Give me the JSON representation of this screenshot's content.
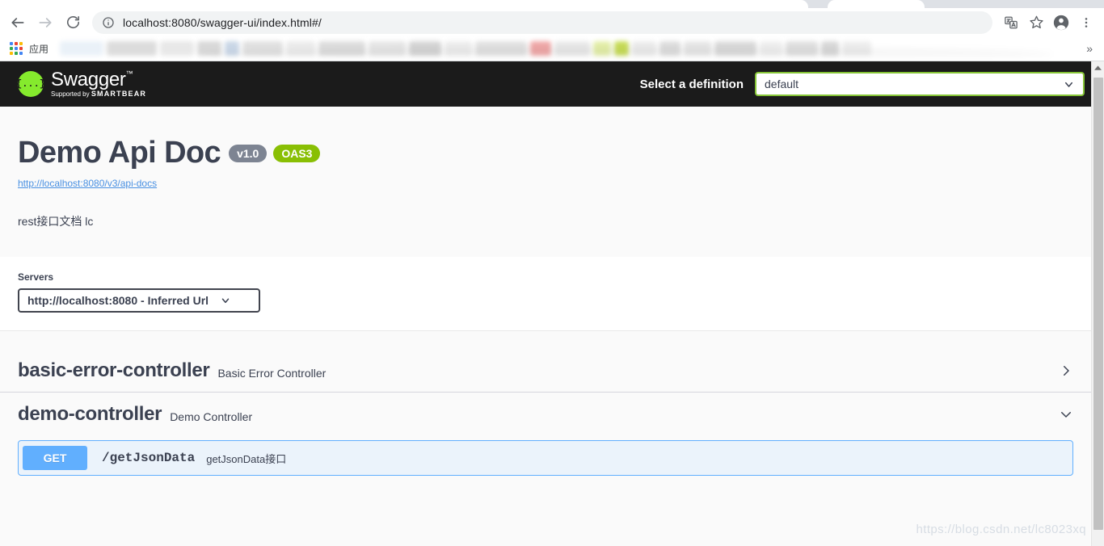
{
  "browser": {
    "nav": {
      "back_title": "Back",
      "forward_title": "Forward",
      "reload_title": "Reload"
    },
    "omnibox": {
      "url": "localhost:8080/swagger-ui/index.html#/",
      "placeholder": "Search Google or type a URL",
      "security_icon": "info-circle-icon"
    },
    "toolbar_icons": [
      "translate-icon",
      "bookmark-star-icon",
      "profile-avatar-icon",
      "more-menu-icon"
    ],
    "bookmarks": {
      "apps_label": "应用",
      "overflow_label": "»"
    }
  },
  "topbar": {
    "logo_mark": "{...}",
    "brand": "Swagger",
    "trademark": "™",
    "supported_prefix": "Supported by",
    "supported_brand": "SMARTBEAR",
    "select_label": "Select a definition",
    "definition_value": "default",
    "chevron": "chevron-down-icon"
  },
  "info": {
    "title": "Demo Api Doc",
    "version_badge": "v1.0",
    "oas_badge": "OAS3",
    "url": "http://localhost:8080/v3/api-docs",
    "description": "rest接口文档 lc"
  },
  "servers": {
    "label": "Servers",
    "selected": "http://localhost:8080 - Inferred Url",
    "options": [
      "http://localhost:8080 - Inferred Url"
    ]
  },
  "tags": [
    {
      "name": "basic-error-controller",
      "description": "Basic Error Controller",
      "expanded": false,
      "chevron": "chevron-right-icon",
      "operations": []
    },
    {
      "name": "demo-controller",
      "description": "Demo Controller",
      "expanded": true,
      "chevron": "chevron-down-icon",
      "operations": [
        {
          "method": "GET",
          "path": "/getJsonData",
          "summary": "getJsonData接口"
        }
      ]
    }
  ],
  "watermark": "https://blog.csdn.net/lc8023xq",
  "colors": {
    "swagger_green": "#85ea2d",
    "oas_green": "#89bf04",
    "version_gray": "#7d8492",
    "get_blue": "#61affe",
    "topbar_black": "#1b1b1b",
    "text": "#3b4151",
    "link": "#4990e2"
  }
}
